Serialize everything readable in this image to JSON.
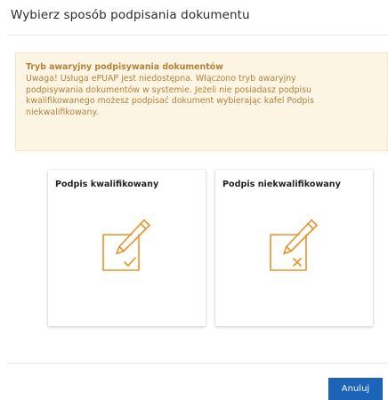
{
  "dialog": {
    "title": "Wybierz sposób podpisania dokumentu"
  },
  "alert": {
    "title": "Tryb awaryjny podpisywania dokumentów",
    "text": "Uwaga! Usługa ePUAP jest niedostępna. Włączono tryb awaryjny podpisywania dokumentów w systemie. Jeżeli nie posiadasz podpisu kwalifikowanego możesz podpisać dokument wybierając kafel Podpis niekwalifikowany."
  },
  "tiles": [
    {
      "title": "Podpis kwalifikowany",
      "icon": "signature-check-icon"
    },
    {
      "title": "Podpis niekwalifikowany",
      "icon": "signature-cross-icon"
    }
  ],
  "footer": {
    "cancel_label": "Anuluj"
  },
  "colors": {
    "accent": "#e8922a",
    "primary_button": "#1b64b8",
    "alert_background": "#fdf5e3",
    "alert_text": "#b2823c"
  }
}
